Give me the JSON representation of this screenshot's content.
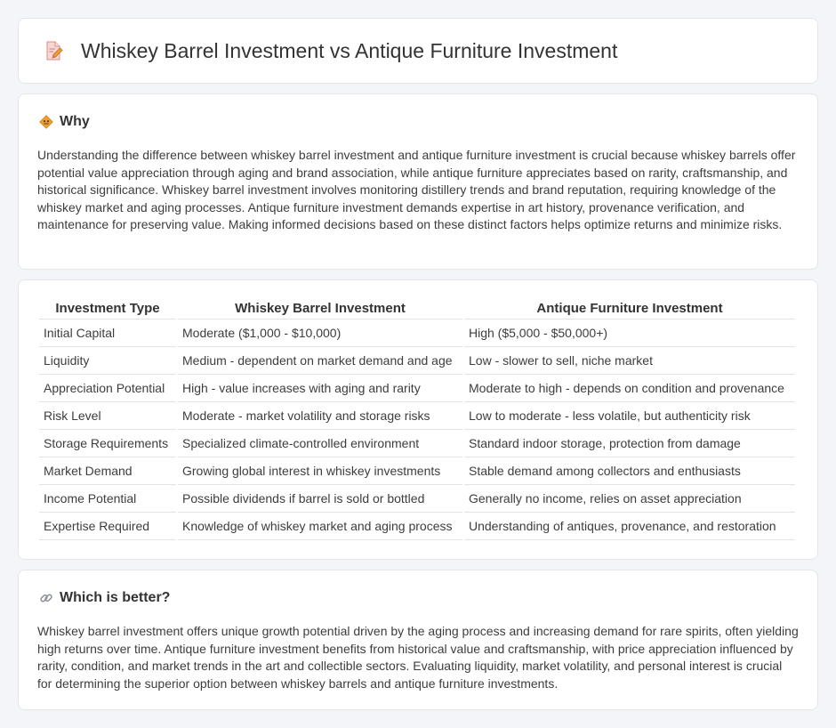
{
  "page": {
    "title": "Whiskey Barrel Investment vs Antique Furniture Investment",
    "title_icon": "document-pencil-icon"
  },
  "why": {
    "heading": "Why",
    "icon": "diamond-sign-icon",
    "body": "Understanding the difference between whiskey barrel investment and antique furniture investment is crucial because whiskey barrels offer potential value appreciation through aging and brand association, while antique furniture appreciates based on rarity, craftsmanship, and historical significance. Whiskey barrel investment involves monitoring distillery trends and brand reputation, requiring knowledge of the whiskey market and aging processes. Antique furniture investment demands expertise in art history, provenance verification, and maintenance for preserving value. Making informed decisions based on these distinct factors helps optimize returns and minimize risks."
  },
  "table": {
    "headers": [
      "Investment Type",
      "Whiskey Barrel Investment",
      "Antique Furniture Investment"
    ],
    "rows": [
      [
        "Initial Capital",
        "Moderate ($1,000 - $10,000)",
        "High ($5,000 - $50,000+)"
      ],
      [
        "Liquidity",
        "Medium - dependent on market demand and age",
        "Low - slower to sell, niche market"
      ],
      [
        "Appreciation Potential",
        "High - value increases with aging and rarity",
        "Moderate to high - depends on condition and provenance"
      ],
      [
        "Risk Level",
        "Moderate - market volatility and storage risks",
        "Low to moderate - less volatile, but authenticity risk"
      ],
      [
        "Storage Requirements",
        "Specialized climate-controlled environment",
        "Standard indoor storage, protection from damage"
      ],
      [
        "Market Demand",
        "Growing global interest in whiskey investments",
        "Stable demand among collectors and enthusiasts"
      ],
      [
        "Income Potential",
        "Possible dividends if barrel is sold or bottled",
        "Generally no income, relies on asset appreciation"
      ],
      [
        "Expertise Required",
        "Knowledge of whiskey market and aging process",
        "Understanding of antiques, provenance, and restoration"
      ]
    ]
  },
  "better": {
    "heading": "Which is better?",
    "icon": "link-icon",
    "body": "Whiskey barrel investment offers unique growth potential driven by the aging process and increasing demand for rare spirits, often yielding high returns over time. Antique furniture investment benefits from historical value and craftsmanship, with price appreciation influenced by rarity, condition, and market trends in the art and collectible sectors. Evaluating liquidity, market volatility, and personal interest is crucial for determining the superior option between whiskey barrels and antique furniture investments."
  },
  "colors": {
    "background": "#f4f5f9",
    "card": "#ffffff",
    "accent_orange": "#f0a030",
    "icon_pink": "#e86a6a"
  }
}
